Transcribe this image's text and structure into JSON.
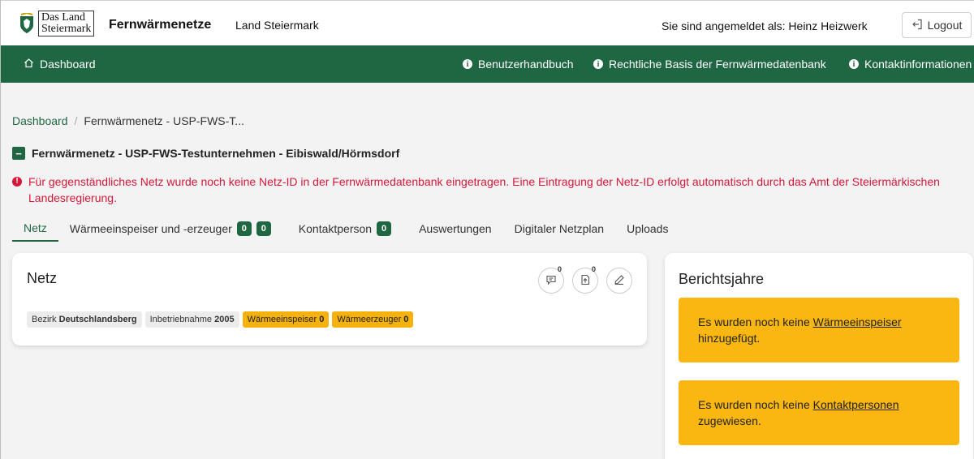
{
  "logo": {
    "line1": "Das Land",
    "line2": "Steiermark"
  },
  "header": {
    "title": "Fernwärmenetze",
    "subtitle": "Land Steiermark",
    "login_text": "Sie sind angemeldet als: Heinz Heizwerk",
    "logout_label": "Logout"
  },
  "nav": {
    "dashboard": "Dashboard",
    "handbook": "Benutzerhandbuch",
    "legal": "Rechtliche Basis der Fernwärmedatenbank",
    "contact": "Kontaktinformationen"
  },
  "breadcrumb": {
    "home": "Dashboard",
    "current": "Fernwärmenetz - USP-FWS-T..."
  },
  "page": {
    "collapse_symbol": "−",
    "title": "Fernwärmenetz - USP-FWS-Testunternehmen - Eibiswald/Hörmsdorf",
    "error": "Für gegenständliches Netz wurde noch keine Netz-ID in der Fernwärmedatenbank eingetragen. Eine Eintragung der Netz-ID erfolgt automatisch durch das Amt der Steiermärkischen Landesregierung."
  },
  "tabs": {
    "netz": "Netz",
    "waerme": "Wärmeeinspeiser und -erzeuger",
    "waerme_badge1": "0",
    "waerme_badge2": "0",
    "kontakt": "Kontaktperson",
    "kontakt_badge": "0",
    "auswertungen": "Auswertungen",
    "netzplan": "Digitaler Netzplan",
    "uploads": "Uploads"
  },
  "netz_card": {
    "title": "Netz",
    "comment_count": "0",
    "upload_count": "0",
    "bezirk_label": "Bezirk",
    "bezirk_value": "Deutschlandsberg",
    "inbetrieb_label": "Inbetriebnahme",
    "inbetrieb_value": "2005",
    "einspeiser_label": "Wärmeeinspeiser",
    "einspeiser_value": "0",
    "erzeuger_label": "Wärmeerzeuger",
    "erzeuger_value": "0"
  },
  "berichte_card": {
    "title": "Berichtsjahre",
    "alert1_pre": "Es wurden noch keine ",
    "alert1_link": "Wärmeeinspeiser",
    "alert1_post": " hinzugefügt.",
    "alert2_pre": "Es wurden noch keine ",
    "alert2_link": "Kontaktpersonen",
    "alert2_post": " zugewiesen."
  },
  "colors": {
    "brand_green": "#1f6643",
    "error_red": "#d6173a",
    "warning_yellow": "#fab711"
  }
}
